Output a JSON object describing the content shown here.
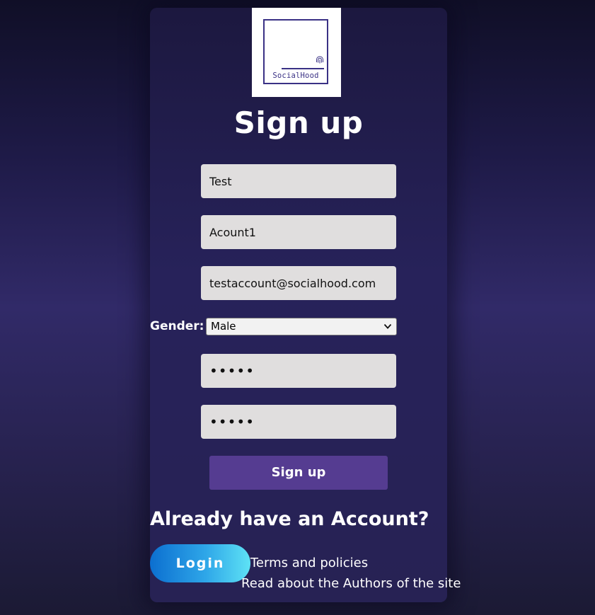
{
  "logo": {
    "text": "SocialHood",
    "brand_color": "#3a3185",
    "icon": "fingerprint-icon"
  },
  "page_title": "Sign up",
  "form": {
    "first_name_value": "Test",
    "last_name_value": "Acount1",
    "email_value": "testaccount@socialhood.com",
    "gender_label": "Gender:",
    "gender_selected": "Male",
    "password_masked": "•••••",
    "confirm_password_masked": "•••••",
    "submit_label": "Sign up"
  },
  "already_text": "Already have an Account?",
  "login_label": "Login",
  "links": {
    "terms": "Terms and policies",
    "authors": "Read about the Authors of the site"
  },
  "colors": {
    "button_primary": "#553c91",
    "field_background": "#e0dede",
    "login_gradient_start": "#0c6fd0",
    "login_gradient_end": "#5ee2f5"
  }
}
